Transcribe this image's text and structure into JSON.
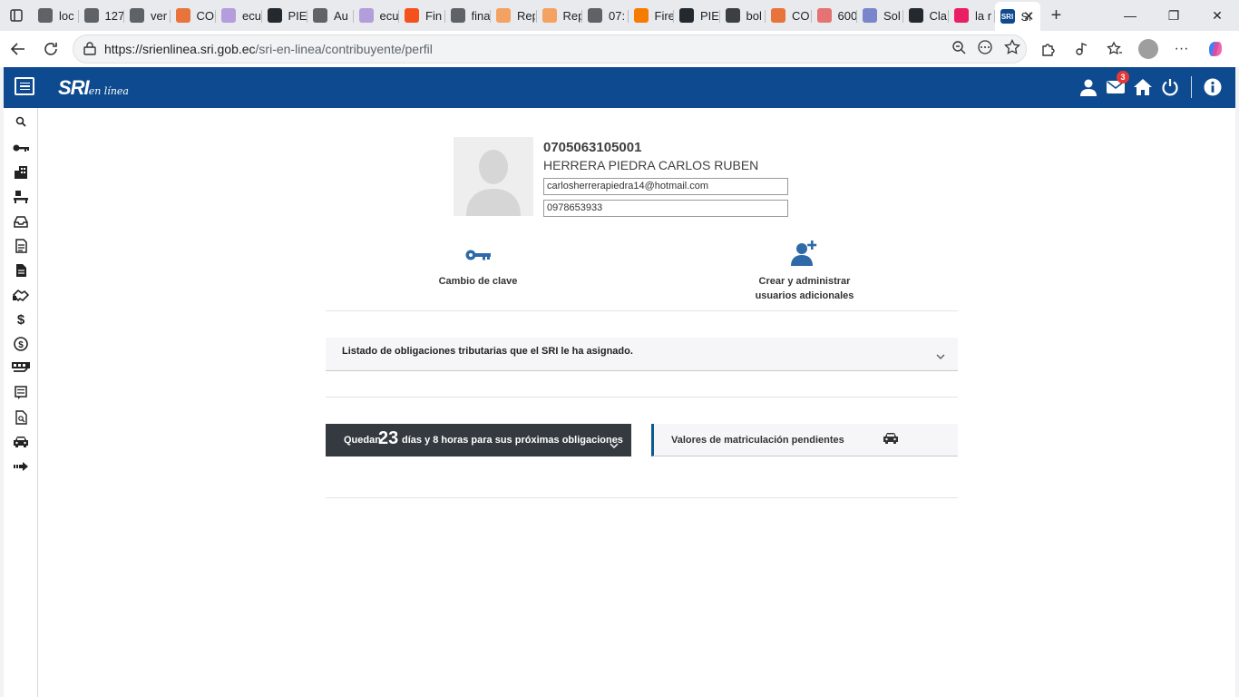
{
  "browser": {
    "tabs": [
      {
        "title": "loc",
        "color": "#5f6368"
      },
      {
        "title": "127",
        "color": "#5f6368"
      },
      {
        "title": "ver",
        "color": "#5f6368"
      },
      {
        "title": "CO",
        "color": "#e8743b"
      },
      {
        "title": "ecu",
        "color": "#b39ddb"
      },
      {
        "title": "PIE",
        "color": "#24292f"
      },
      {
        "title": "Au",
        "color": "#5f6368"
      },
      {
        "title": "ecu",
        "color": "#b39ddb"
      },
      {
        "title": "Fin",
        "color": "#f4511e"
      },
      {
        "title": "fina",
        "color": "#5f6368"
      },
      {
        "title": "Rep",
        "color": "#f4a261"
      },
      {
        "title": "Rep",
        "color": "#f4a261"
      },
      {
        "title": "07:",
        "color": "#5f6368"
      },
      {
        "title": "Fire",
        "color": "#f57c00"
      },
      {
        "title": "PIE",
        "color": "#24292f"
      },
      {
        "title": "bol",
        "color": "#3c4043"
      },
      {
        "title": "CO",
        "color": "#e8743b"
      },
      {
        "title": "600",
        "color": "#e57373"
      },
      {
        "title": "Sol",
        "color": "#7986cb"
      },
      {
        "title": "Cla",
        "color": "#24292f"
      },
      {
        "title": "la r",
        "color": "#e91e63"
      }
    ],
    "active_tab": {
      "title": "SRI",
      "color": "#0d4a8f"
    },
    "url_host": "https://srienlinea.sri.gob.ec",
    "url_path": "/sri-en-linea/contribuyente/perfil"
  },
  "header": {
    "logo_main": "SRI",
    "logo_sub": "en línea",
    "mail_badge": "3"
  },
  "profile": {
    "ruc": "0705063105001",
    "name": "HERRERA PIEDRA CARLOS RUBEN",
    "email": "carlosherrerapiedra14@hotmail.com",
    "phone": "0978653933"
  },
  "actions": {
    "change_password": "Cambio de clave",
    "users_line1": "Crear y administrar",
    "users_line2": "usuarios adicionales"
  },
  "obligations": {
    "label": "Listado de obligaciones tributarias que el SRI le ha asignado."
  },
  "deadline": {
    "prefix": "Quedan",
    "days": "23",
    "suffix": "días y 8 horas para sus próximas obligaciones"
  },
  "vehicles": {
    "label": "Valores de matriculación pendientes"
  }
}
